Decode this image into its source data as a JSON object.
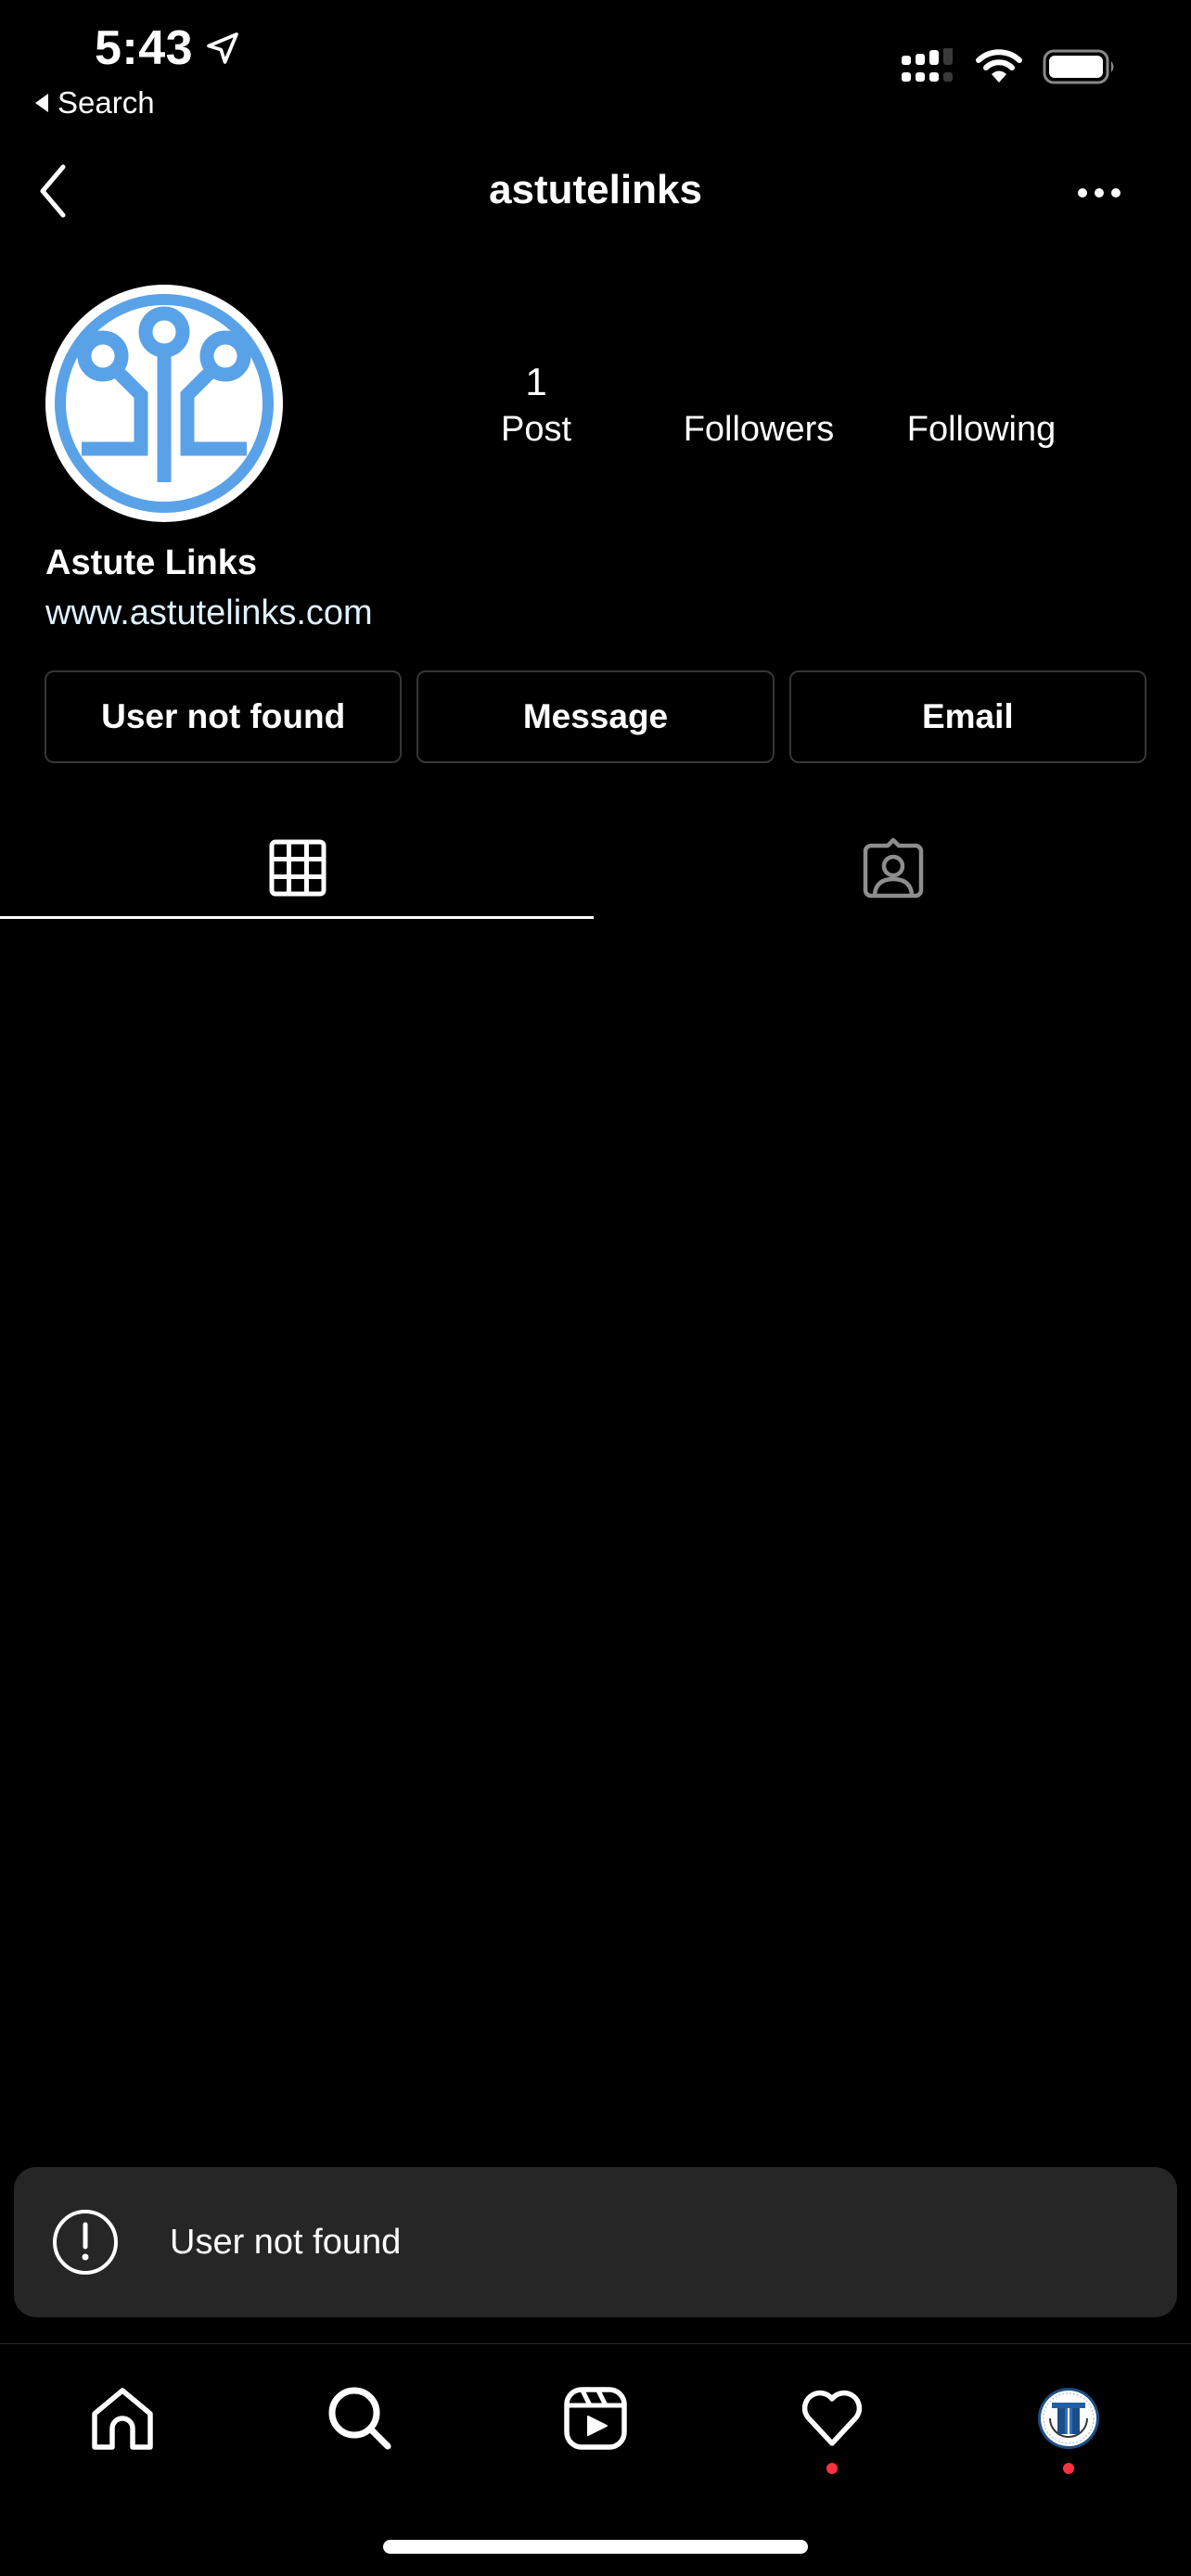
{
  "status_bar": {
    "time": "5:43",
    "back_app_label": "Search",
    "location_icon": "location-arrow-icon",
    "signal_icon": "dual-sim-signal-icon",
    "wifi_icon": "wifi-icon",
    "battery_icon": "battery-full-icon"
  },
  "header": {
    "username": "astutelinks",
    "back_icon": "chevron-left-icon",
    "more_icon": "more-horizontal-icon"
  },
  "profile": {
    "display_name": "Astute Links",
    "website": "www.astutelinks.com",
    "brand_color": "#5aa2e8",
    "stats": {
      "posts_count": "1",
      "posts_label": "Post",
      "followers_label": "Followers",
      "following_label": "Following"
    }
  },
  "actions": {
    "primary_label": "User not found",
    "message_label": "Message",
    "email_label": "Email"
  },
  "tabs": [
    {
      "name": "posts-grid",
      "icon": "grid-icon",
      "active": true
    },
    {
      "name": "tagged",
      "icon": "tagged-person-icon",
      "active": false
    }
  ],
  "toast": {
    "icon": "alert-circle-icon",
    "message": "User not found"
  },
  "bottom_nav": {
    "items": [
      {
        "name": "home",
        "icon": "home-icon",
        "badge": false
      },
      {
        "name": "search",
        "icon": "search-icon",
        "badge": false
      },
      {
        "name": "reels",
        "icon": "reels-icon",
        "badge": false
      },
      {
        "name": "activity",
        "icon": "heart-icon",
        "badge": true
      },
      {
        "name": "profile",
        "icon": "profile-avatar-icon",
        "badge": true
      }
    ],
    "badge_color": "#ff3040"
  }
}
